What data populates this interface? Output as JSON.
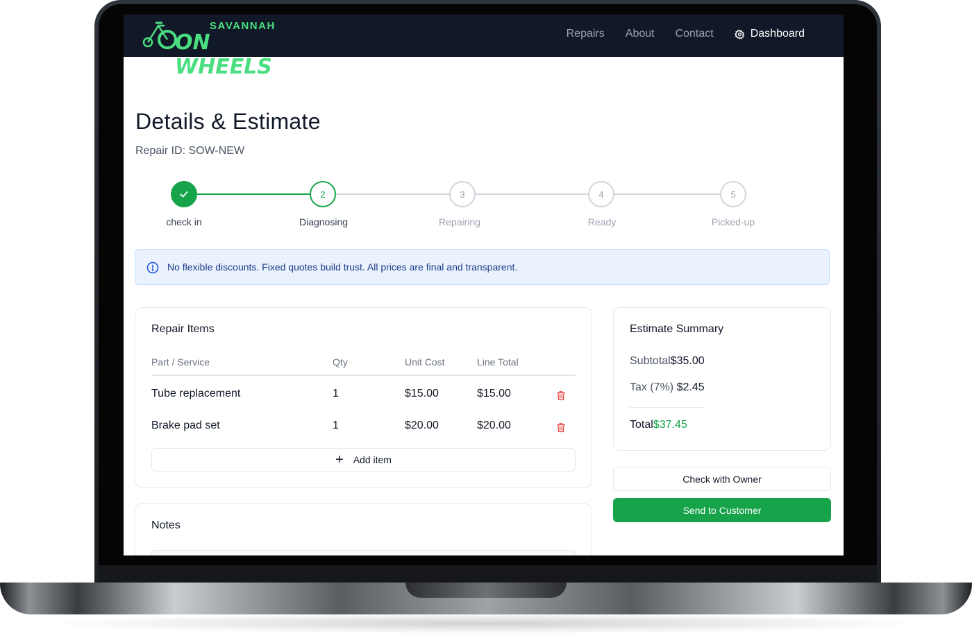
{
  "brand": {
    "small": "SAVANNAH",
    "big": "ON WHEELS"
  },
  "nav": {
    "repairs": "Repairs",
    "about": "About",
    "contact": "Contact",
    "dashboard": "Dashboard"
  },
  "page": {
    "title": "Details & Estimate",
    "repair_id": "Repair ID: SOW-NEW"
  },
  "steps": [
    {
      "number": "",
      "label": "check in",
      "state": "done"
    },
    {
      "number": "2",
      "label": "Diagnosing",
      "state": "active"
    },
    {
      "number": "3",
      "label": "Repairing",
      "state": "pending"
    },
    {
      "number": "4",
      "label": "Ready",
      "state": "pending"
    },
    {
      "number": "5",
      "label": "Picked-up",
      "state": "pending"
    }
  ],
  "alert": {
    "text": "No flexible discounts. Fixed quotes build trust. All prices are final and transparent."
  },
  "repair_items": {
    "title": "Repair Items",
    "headers": {
      "part": "Part / Service",
      "qty": "Qty",
      "unit": "Unit Cost",
      "total": "Line Total"
    },
    "rows": [
      {
        "part": "Tube replacement",
        "qty": "1",
        "unit": "$15.00",
        "total": "$15.00"
      },
      {
        "part": "Brake pad set",
        "qty": "1",
        "unit": "$20.00",
        "total": "$20.00"
      }
    ],
    "add_label": "Add item"
  },
  "notes": {
    "title": "Notes"
  },
  "summary": {
    "title": "Estimate Summary",
    "subtotal_label": "Subtotal",
    "subtotal_value": "$35.00",
    "tax_label": "Tax (7%)",
    "tax_value": "$2.45",
    "total_label": "Total",
    "total_value": "$37.45"
  },
  "actions": {
    "check_owner": "Check with Owner",
    "send_customer": "Send to Customer"
  },
  "colors": {
    "accent": "#16a34a",
    "navbar": "#111827",
    "alert_bg": "#eaf3fd",
    "danger": "#ef4444",
    "brand": "#4ade80"
  }
}
